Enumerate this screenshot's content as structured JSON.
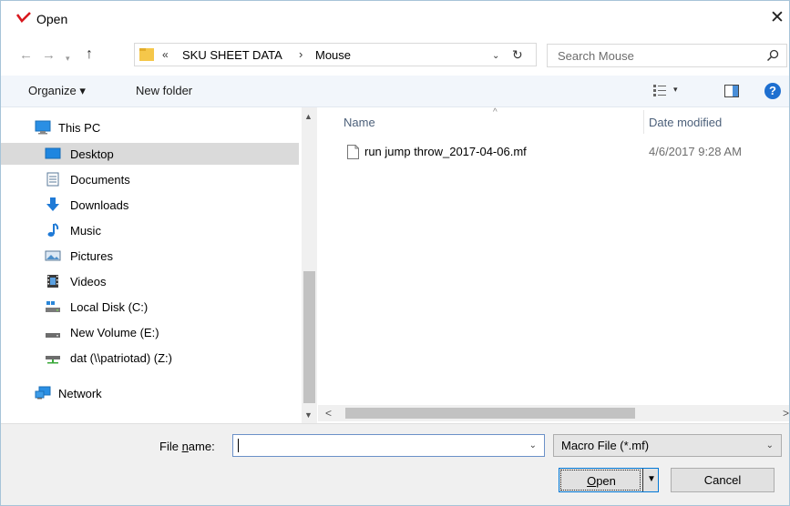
{
  "window": {
    "title": "Open",
    "close_glyph": "✕"
  },
  "nav": {
    "back_glyph": "←",
    "forward_glyph": "→",
    "recent_glyph": "▾",
    "up_glyph": "↑",
    "breadcrumb_chevron": "«",
    "breadcrumb": [
      "SKU SHEET DATA",
      "Mouse"
    ],
    "separator": "›",
    "dropdown_glyph": "⌄",
    "refresh_glyph": "↻"
  },
  "search": {
    "placeholder": "Search Mouse"
  },
  "toolbar": {
    "organize_label": "Organize ▾",
    "new_folder_label": "New folder",
    "views_drop": "▾",
    "help_label": "?"
  },
  "tree": {
    "this_pc": "This PC",
    "desktop": "Desktop",
    "documents": "Documents",
    "downloads": "Downloads",
    "music": "Music",
    "pictures": "Pictures",
    "videos": "Videos",
    "local_disk": "Local Disk (C:)",
    "new_volume": "New Volume (E:)",
    "network_drive": "dat (\\\\patriotad) (Z:)",
    "network": "Network"
  },
  "scroll": {
    "up": "▲",
    "down": "▼",
    "left": "<",
    "right": ">"
  },
  "columns": {
    "sort_glyph": "^",
    "name": "Name",
    "date_modified": "Date modified"
  },
  "files": [
    {
      "name": "run jump throw_2017-04-06.mf",
      "date": "4/6/2017 9:28 AM"
    }
  ],
  "bottom": {
    "file_name_prefix": "File ",
    "file_name_accel": "n",
    "file_name_suffix": "ame:",
    "file_name_value": "",
    "dropdown_glyph": "⌄",
    "file_type": "Macro File (*.mf)",
    "open_accel": "O",
    "open_rest": "pen",
    "open_drop": "▼",
    "cancel_label": "Cancel"
  },
  "colors": {
    "accent": "#0078d7",
    "selected": "#dadada",
    "toolbar": "#f2f6fb",
    "help": "#1e6fd0"
  }
}
